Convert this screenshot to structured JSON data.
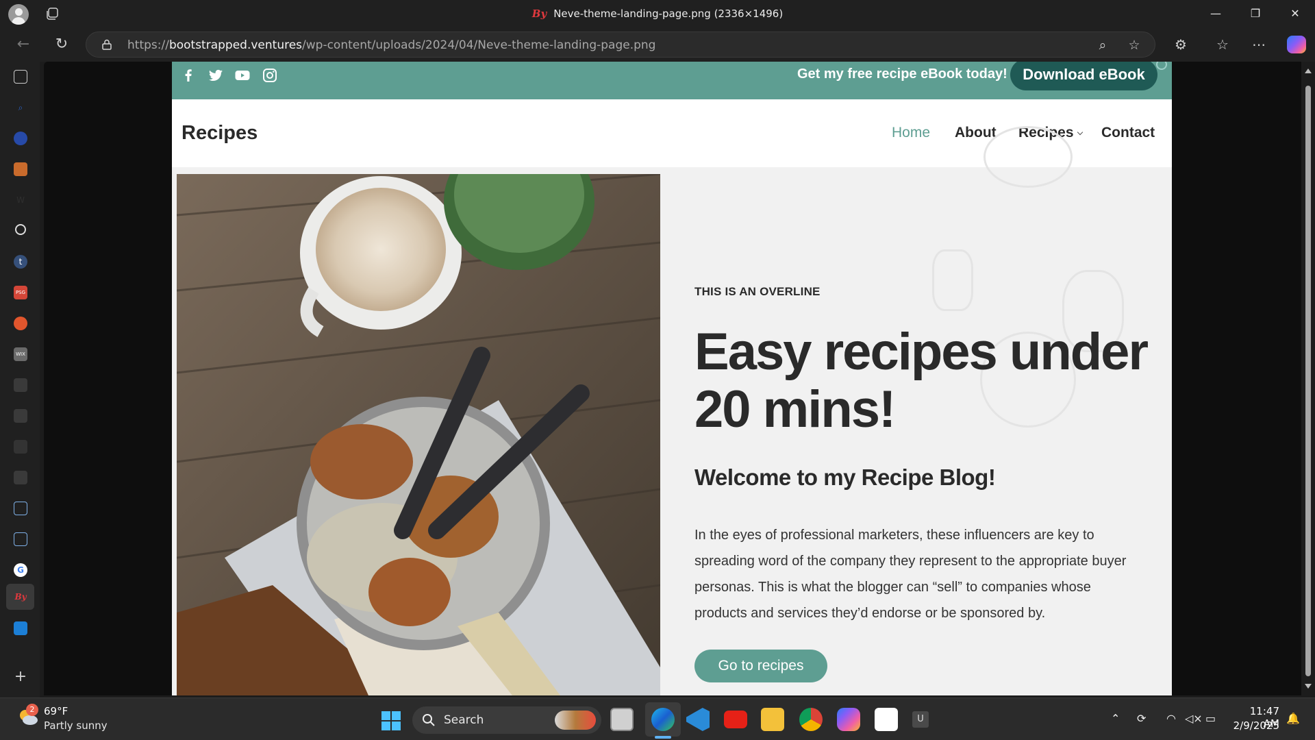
{
  "browser": {
    "tab_title": "Neve-theme-landing-page.png (2336×1496)",
    "favicon_text": "By",
    "url_prefix": "https://",
    "url_domain": "bootstrapped.ventures",
    "url_path": "/wp-content/uploads/2024/04/Neve-theme-landing-page.png"
  },
  "site": {
    "promo_text": "Get my free recipe eBook today!",
    "promo_button": "Download eBook",
    "brand": "Recipes",
    "menu": [
      {
        "label": "Home",
        "active": true
      },
      {
        "label": "About"
      },
      {
        "label": "Recipes",
        "has_submenu": true
      },
      {
        "label": "Contact"
      }
    ],
    "social_icons": [
      "facebook-icon",
      "twitter-icon",
      "youtube-icon",
      "instagram-icon"
    ],
    "hero": {
      "overline": "THIS IS AN OVERLINE",
      "headline_line1": "Easy recipes under",
      "headline_line2": "20 mins!",
      "subheadline": "Welcome to my Recipe Blog!",
      "paragraph": "In the eyes of professional marketers, these influencers are key to spreading word of the company they represent to the appropriate buyer personas. This is what the blogger can “sell” to companies whose products and services they’d endorse or be sponsored by.",
      "cta": "Go to recipes"
    }
  },
  "taskbar": {
    "weather_temp": "69°F",
    "weather_desc": "Partly sunny",
    "weather_badge": "2",
    "search_label": "Search",
    "time": "11:47 AM",
    "date": "2/9/2025"
  },
  "colors": {
    "accent": "#5e9e92",
    "dark_button": "#1f5a55",
    "text": "#2a2a2a"
  }
}
